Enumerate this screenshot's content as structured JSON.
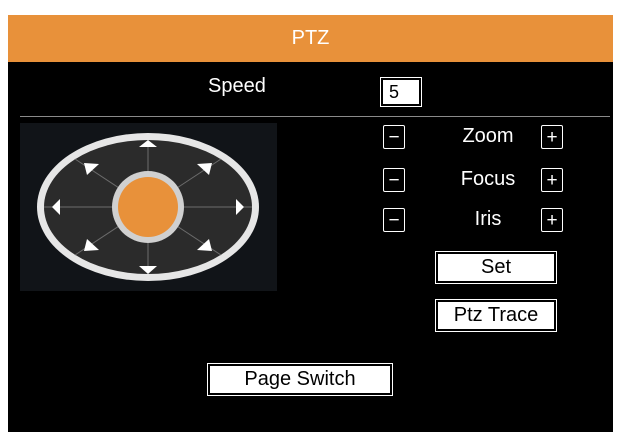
{
  "window": {
    "title": "PTZ"
  },
  "speed": {
    "label": "Speed",
    "value": "5"
  },
  "dpad": {
    "icon": "directional-pad",
    "colors": {
      "center": "#e8913a",
      "ring": "#cfcfcf",
      "body": "#2b2b2b"
    }
  },
  "controls": [
    {
      "label": "Zoom",
      "minus": "−",
      "plus": "+"
    },
    {
      "label": "Focus",
      "minus": "−",
      "plus": "+"
    },
    {
      "label": "Iris",
      "minus": "−",
      "plus": "+"
    }
  ],
  "buttons": {
    "set": "Set",
    "ptz_trace": "Ptz Trace",
    "page_switch": "Page Switch"
  },
  "colors": {
    "accent": "#e8913a",
    "background": "#000000",
    "text": "#ffffff"
  }
}
